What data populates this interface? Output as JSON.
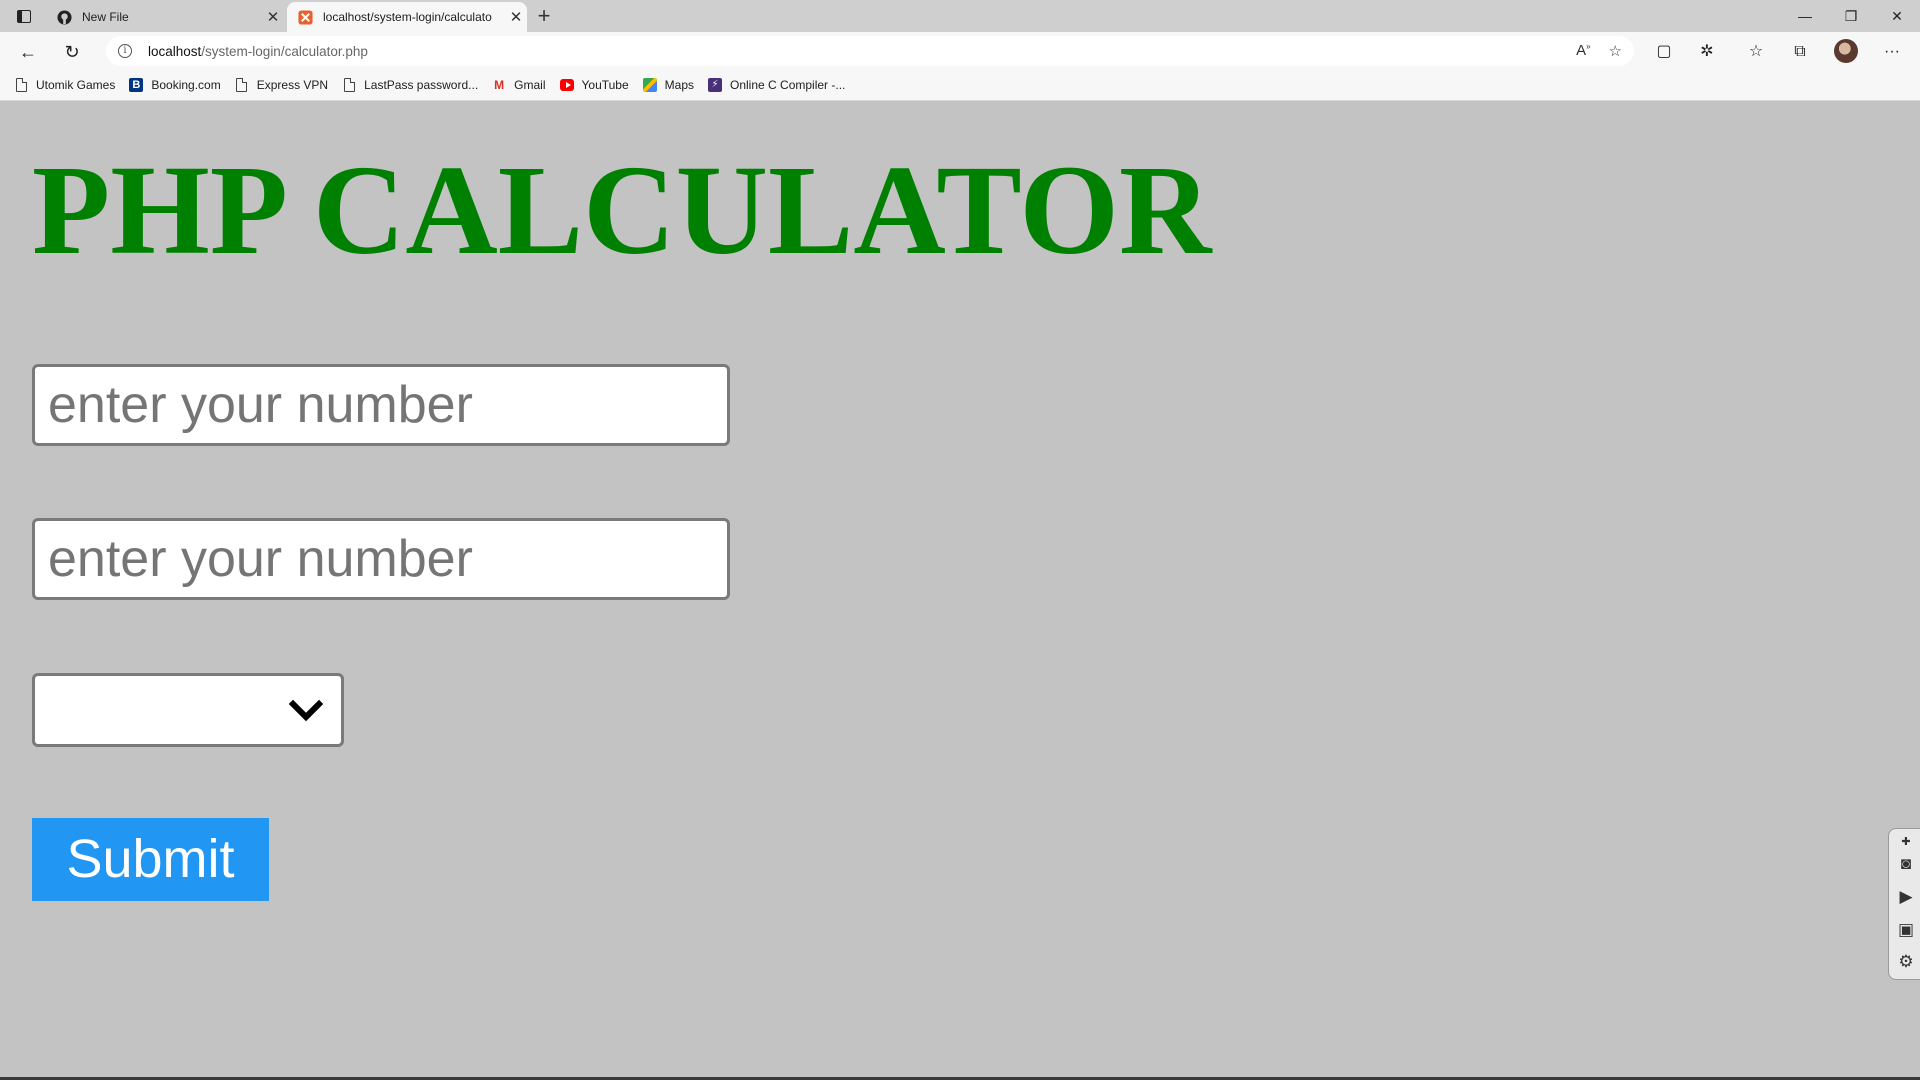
{
  "browser": {
    "tabs": [
      {
        "title": "New File",
        "icon": "github-icon",
        "active": false
      },
      {
        "title": "localhost/system-login/calculato",
        "icon": "xampp-icon",
        "active": true
      }
    ],
    "url_host": "localhost",
    "url_path": "/system-login/calculator.php",
    "bookmarks": [
      {
        "label": "Utomik Games",
        "icon": "page-icon"
      },
      {
        "label": "Booking.com",
        "icon": "booking-icon"
      },
      {
        "label": "Express VPN",
        "icon": "page-icon"
      },
      {
        "label": "LastPass password...",
        "icon": "page-icon"
      },
      {
        "label": "Gmail",
        "icon": "gmail-icon"
      },
      {
        "label": "YouTube",
        "icon": "youtube-icon"
      },
      {
        "label": "Maps",
        "icon": "maps-icon"
      },
      {
        "label": "Online C Compiler -...",
        "icon": "compiler-icon"
      }
    ]
  },
  "page": {
    "title": "PHP CALCULATOR",
    "title_color": "#008000",
    "background": "#c3c3c3",
    "first_number_placeholder": "enter your number",
    "second_number_placeholder": "enter your number",
    "operator_selected": "",
    "submit_label": "Submit",
    "submit_color": "#2196f3"
  }
}
